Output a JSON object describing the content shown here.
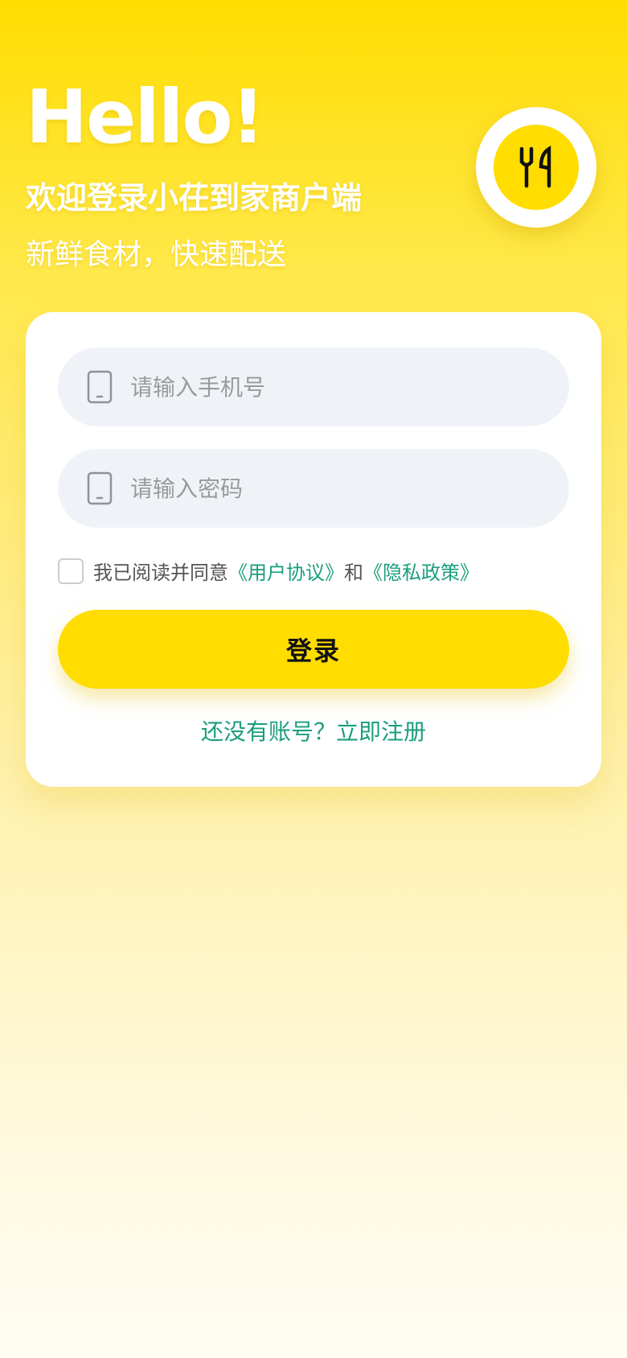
{
  "header": {
    "greeting": "Hello!",
    "welcome": "欢迎登录小茌到家商户端",
    "slogan": "新鲜食材，快速配送",
    "logo_icon": "fork-knife-icon"
  },
  "form": {
    "phone": {
      "placeholder": "请输入手机号",
      "value": "",
      "icon": "phone-icon"
    },
    "password": {
      "placeholder": "请输入密码",
      "value": "",
      "icon": "phone-icon"
    },
    "agreement": {
      "prefix": "我已阅读并同意",
      "user_agreement": "《用户协议》",
      "conjunction": "和",
      "privacy_policy": "《隐私政策》",
      "checked": false
    },
    "login_label": "登录",
    "register_link": "还没有账号？立即注册"
  },
  "colors": {
    "primary": "#FFDD00",
    "link": "#1A9E7C",
    "input_bg": "#EFF3F8"
  }
}
